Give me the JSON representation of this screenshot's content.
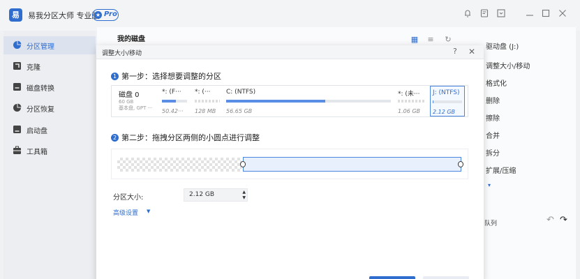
{
  "app": {
    "title": "易我分区大师 专业版",
    "pro_badge": "Pro",
    "logo_glyph": "易"
  },
  "sidebar": {
    "items": [
      {
        "label": "分区管理",
        "icon": "pie-icon",
        "active": true
      },
      {
        "label": "克隆",
        "icon": "clone-icon"
      },
      {
        "label": "磁盘转换",
        "icon": "convert-icon"
      },
      {
        "label": "分区恢复",
        "icon": "recovery-icon"
      },
      {
        "label": "启动盘",
        "icon": "bootdisk-icon"
      },
      {
        "label": "工具箱",
        "icon": "toolbox-icon"
      }
    ]
  },
  "main": {
    "title": "我的磁盘"
  },
  "ops": {
    "items": [
      "驱动盘 (J:)",
      "调整大小/移动",
      "格式化",
      "删除",
      "擦除",
      "合并",
      "拆分",
      "扩展/压缩"
    ],
    "caret": "▾",
    "bottom_label": "队列"
  },
  "dialog": {
    "title": "调整大小/移动",
    "help": "?",
    "close": "✕",
    "step1": {
      "num": "1",
      "label": "第一步：选择想要调整的分区"
    },
    "step2": {
      "num": "2",
      "label": "第二步：拖拽分区两侧的小圆点进行调整"
    },
    "disk": {
      "name": "磁盘 0",
      "size": "60 GB",
      "type": "基本盘, GPT ···"
    },
    "partitions": [
      {
        "label": "*: (F···",
        "size": "50.42···",
        "fill": 0.55
      },
      {
        "label": "*: (···",
        "size": "128 MB",
        "fill": 0.0
      },
      {
        "label": "C: (NTFS)",
        "size": "56.65 GB",
        "fill": 0.6
      },
      {
        "label": "*: (未···",
        "size": "1.06 GB",
        "fill": 0.0
      },
      {
        "label": "J: (NTFS)",
        "size": "2.12 GB",
        "fill": 0.03
      }
    ],
    "size_field": {
      "label": "分区大小:",
      "value": "2.12 GB"
    },
    "advanced": {
      "label": "高级设置",
      "caret": "▼"
    }
  }
}
